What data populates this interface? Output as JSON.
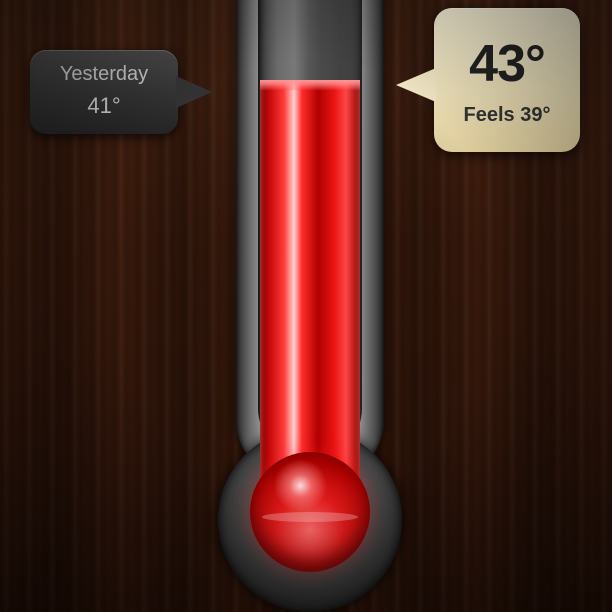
{
  "current": {
    "temperature": "43°",
    "feels_like": "Feels 39°"
  },
  "yesterday": {
    "label": "Yesterday",
    "temperature": "41°"
  },
  "thermometer": {
    "level_fraction": 0.84
  },
  "colors": {
    "mercury": "#e31b1b",
    "current_bubble": "#ece0b8",
    "yesterday_bubble": "#333333",
    "wood": "#3a1a0c"
  }
}
